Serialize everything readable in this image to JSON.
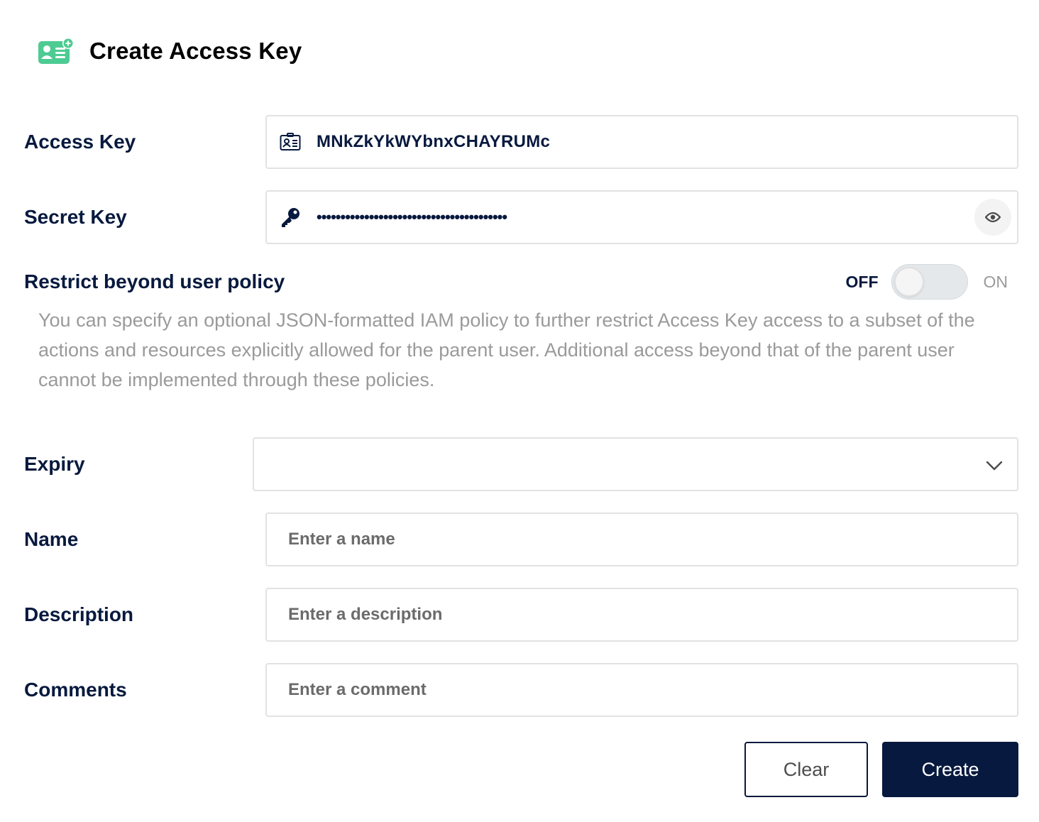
{
  "header": {
    "title": "Create Access Key",
    "icon": "add-access-key-icon",
    "icon_color": "#4ccb92"
  },
  "form": {
    "access_key": {
      "label": "Access Key",
      "value": "MNkZkYkWYbnxCHAYRUMc",
      "icon": "id-card-icon"
    },
    "secret_key": {
      "label": "Secret Key",
      "masked_value": "••••••••••••••••••••••••••••••••••••••••",
      "icon": "key-icon",
      "toggle_icon": "eye-icon"
    },
    "restrict": {
      "label": "Restrict beyond user policy",
      "off_label": "OFF",
      "on_label": "ON",
      "state": "off",
      "description": "You can specify an optional JSON-formatted IAM policy to further restrict Access Key access to a subset of the actions and resources explicitly allowed for the parent user. Additional access beyond that of the parent user cannot be implemented through these policies."
    },
    "expiry": {
      "label": "Expiry",
      "value": ""
    },
    "name": {
      "label": "Name",
      "value": "",
      "placeholder": "Enter a name"
    },
    "description": {
      "label": "Description",
      "value": "",
      "placeholder": "Enter a description"
    },
    "comments": {
      "label": "Comments",
      "value": "",
      "placeholder": "Enter a comment"
    }
  },
  "actions": {
    "clear_label": "Clear",
    "create_label": "Create"
  },
  "colors": {
    "primary": "#07193e",
    "accent": "#4ccb92",
    "muted_text": "#9a9a9a",
    "border": "#e2e2e2"
  }
}
